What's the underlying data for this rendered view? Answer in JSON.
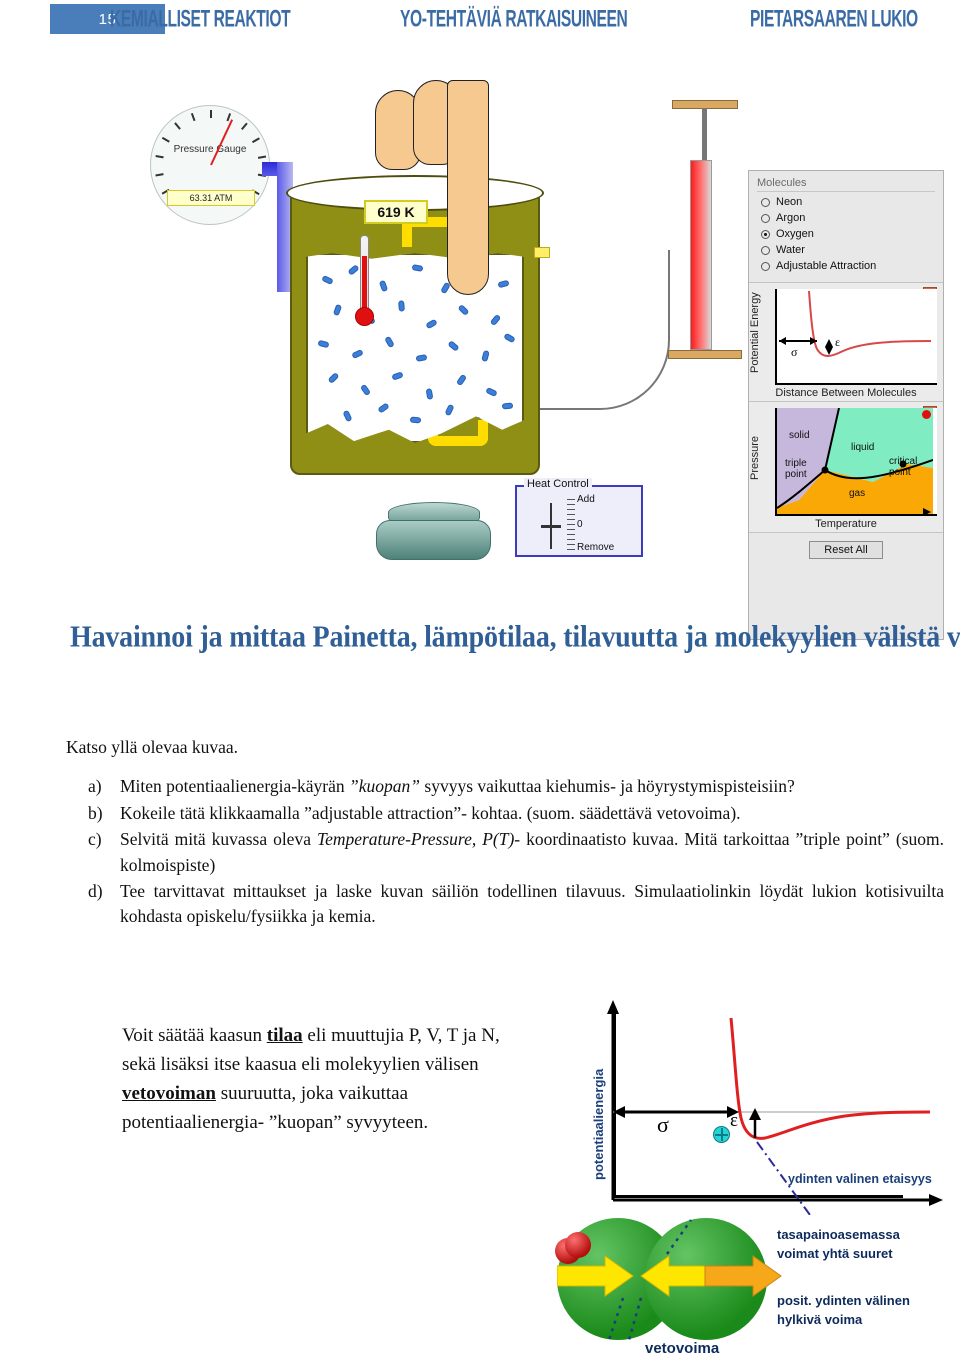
{
  "header": {
    "page_number": "15",
    "left_title": "KEMIALLISET REAKTIOT",
    "center_title": "YO-TEHTÄVIÄ RATKAISUINEEN",
    "right_title": "PIETARSAAREN LUKIO"
  },
  "simulation": {
    "pressure_gauge": {
      "label": "Pressure Gauge",
      "value": "63.31 ATM"
    },
    "thermometer": {
      "value": "619 K"
    },
    "heat_control": {
      "title": "Heat Control",
      "add_label": "Add",
      "zero_label": "0",
      "remove_label": "Remove"
    },
    "panel": {
      "molecules_title": "Molecules",
      "molecules": [
        {
          "label": "Neon",
          "selected": false
        },
        {
          "label": "Argon",
          "selected": false
        },
        {
          "label": "Oxygen",
          "selected": true
        },
        {
          "label": "Water",
          "selected": false
        },
        {
          "label": "Adjustable Attraction",
          "selected": false
        }
      ],
      "energy_chart": {
        "ylabel": "Potential Energy",
        "xlabel": "Distance Between Molecules",
        "sigma": "σ",
        "epsilon": "ε",
        "close_icon": "×"
      },
      "phase_chart": {
        "ylabel": "Pressure",
        "xlabel": "Temperature",
        "solid": "solid",
        "liquid": "liquid",
        "gas": "gas",
        "triple_point": "triple point",
        "critical_point": "critical point",
        "close_icon": "×"
      },
      "reset_button": "Reset All"
    }
  },
  "deco_title": "Havainnoi ja mittaa Painetta, lämpötilaa, tilavuutta ja molekyylien välistä vuorovaikutusta",
  "body": {
    "intro": "Katso yllä olevaa kuvaa.",
    "questions": [
      {
        "mark": "a)",
        "pre": "Miten potentiaalienergia-käyrän ",
        "em": "”kuopan”",
        "post": " syvyys vaikuttaa kiehumis- ja höyrystymispisteisiin?"
      },
      {
        "mark": "b)",
        "pre": "Kokeile tätä klikkaamalla ”adjustable attraction”- kohtaa. (suom. säädettävä vetovoima).",
        "em": "",
        "post": ""
      },
      {
        "mark": "c)",
        "pre": "Selvitä mitä kuvassa oleva ",
        "em": "Temperature-Pressure, P(T)",
        "post": "- koordinaatisto kuvaa. Mitä tarkoittaa ”triple point” (suom. kolmoispiste)"
      },
      {
        "mark": "d)",
        "pre": "Tee tarvittavat mittaukset ja laske kuvan säiliön todellinen tilavuus. Simulaatiolinkin löydät lukion kotisivuilta kohdasta opiskelu/fysiikka ja kemia.",
        "em": "",
        "post": ""
      }
    ],
    "bottom_paragraph": {
      "p1": "Voit säätää kaasun ",
      "b1": "tilaa",
      "p2": " eli muuttujia P, V, T ja N, sekä lisäksi itse kaasua eli molekyylien välisen ",
      "b2": "vetovoiman",
      "p3": " suuruutta, joka vaikuttaa potentiaalienergia- ”kuopan” syvyyteen."
    }
  },
  "figure": {
    "ylabel": "potentiaalienergia",
    "xlabel": "ydinten valinen etaisyys",
    "sigma": "σ",
    "epsilon": "ε",
    "note_equilibrium": "tasapainoasemassa\nvoimat yhtä suuret",
    "note_repulsion": "posit. ydinten välinen\nhylkivä voima",
    "label_attraction": "vetovoima"
  },
  "colors": {
    "header_blue": "#3b6ba5",
    "page_box_blue": "#4a7ebb",
    "deco_blue": "#2f5f96",
    "curve_red": "#e02020",
    "tank_olive": "#8f8f16",
    "molecule_blue": "#3b7fdb",
    "phase_solid": "#c6b8dd",
    "phase_liquid": "#7fecc2",
    "phase_gas": "#f9a806",
    "figure_label_blue": "#1b3f7a",
    "ball_green": "#1a8a1a",
    "arrow_yellow": "#ffe600"
  }
}
